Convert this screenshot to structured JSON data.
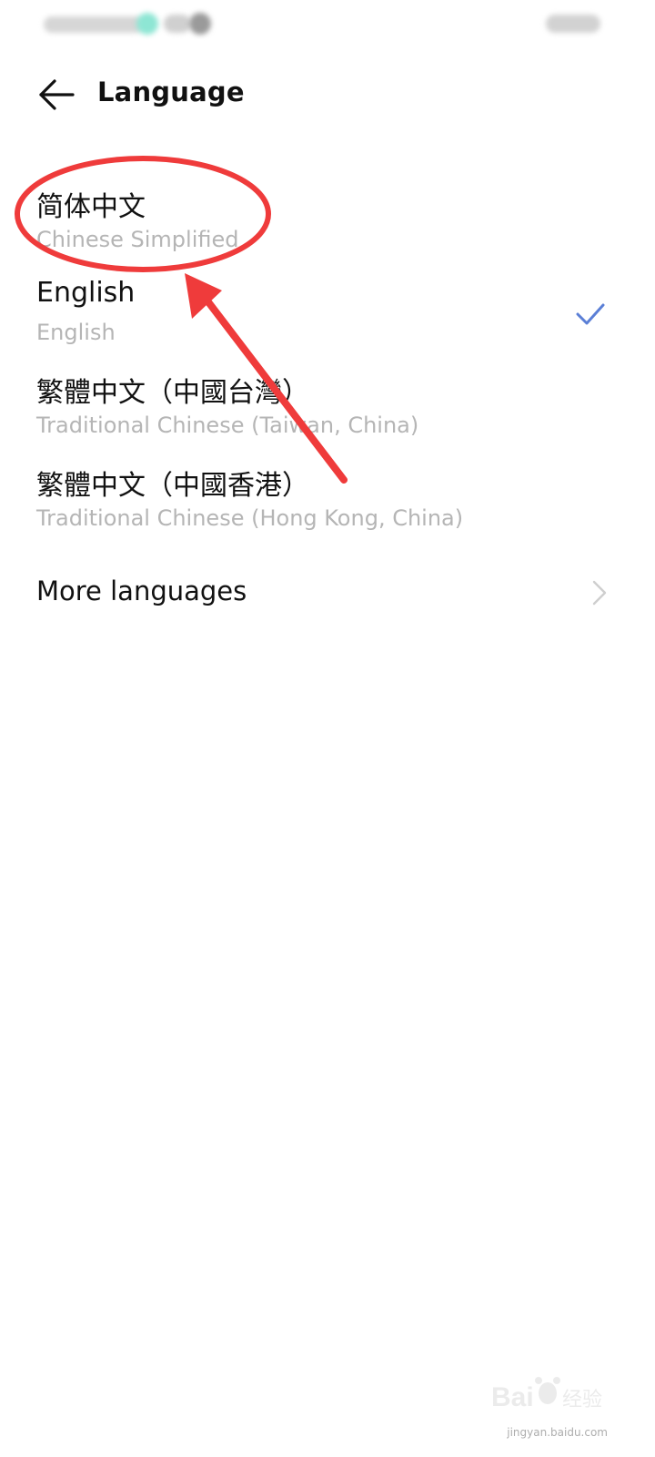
{
  "header": {
    "title": "Language"
  },
  "languages": [
    {
      "native": "简体中文",
      "english": "Chinese Simplified",
      "selected": false
    },
    {
      "native": "English",
      "english": "English",
      "selected": true
    },
    {
      "native": "繁體中文（中國台灣）",
      "english": "Traditional Chinese (Taiwan, China)",
      "selected": false
    },
    {
      "native": "繁體中文（中國香港）",
      "english": "Traditional Chinese (Hong Kong, China)",
      "selected": false
    }
  ],
  "more": {
    "label": "More languages"
  },
  "icons": {
    "back": "back-arrow-icon",
    "check": "checkmark-icon",
    "chevron": "chevron-right-icon"
  },
  "colors": {
    "accent_check": "#5b7fd6",
    "annotation": "#ef3b3b",
    "secondary_text": "#b5b5b5"
  },
  "watermark": {
    "brand": "Bai du 经验",
    "url": "jingyan.baidu.com"
  }
}
